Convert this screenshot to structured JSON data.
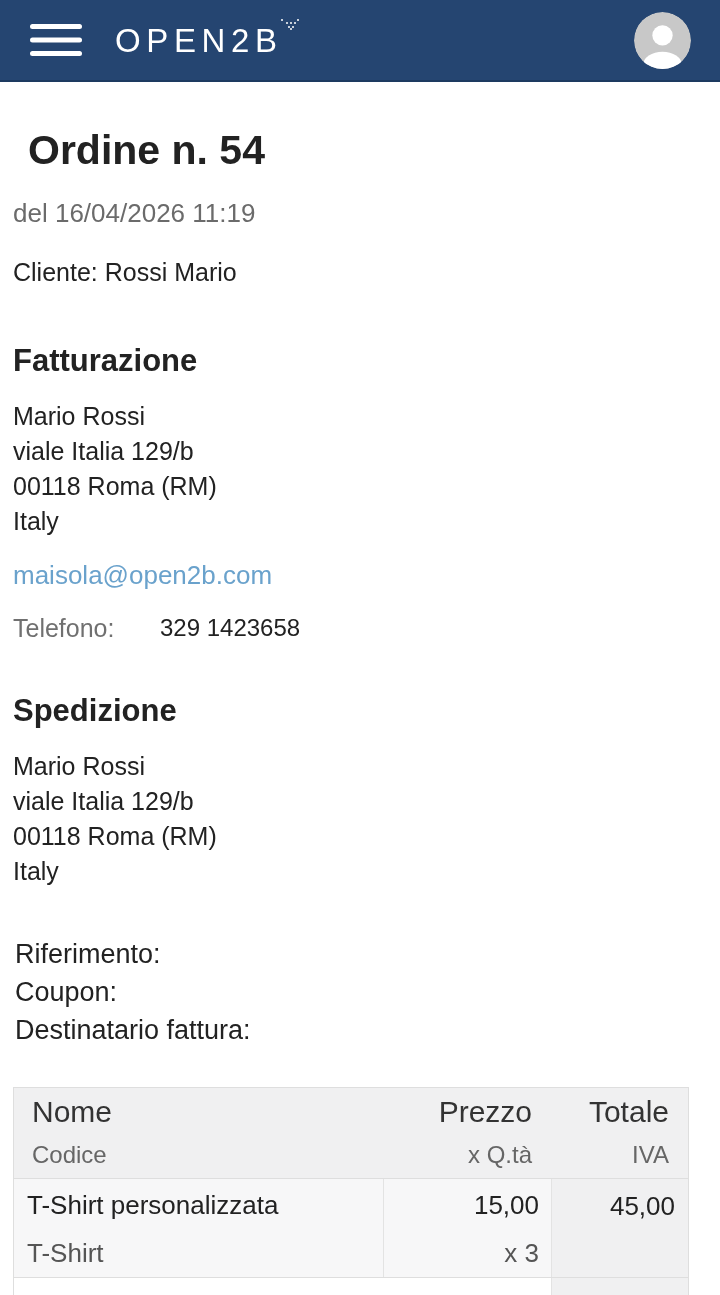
{
  "header": {
    "logo": "OPEN2B"
  },
  "order": {
    "title": "Ordine n. 54",
    "date": "del 16/04/2026 11:19",
    "customer": "Cliente: Rossi Mario"
  },
  "billing": {
    "heading": "Fatturazione",
    "address_lines": [
      "Mario Rossi",
      "viale Italia 129/b",
      "00118 Roma (RM)",
      "Italy"
    ],
    "email": "maisola@open2b.com",
    "phone": {
      "label": "Telefono:",
      "value": "329 1423658"
    }
  },
  "shipping": {
    "heading": "Spedizione",
    "address_lines": [
      "Mario Rossi",
      "viale Italia 129/b",
      "00118 Roma (RM)",
      "Italy"
    ]
  },
  "references": [
    "Riferimento:",
    "Coupon:",
    "Destinatario fattura:"
  ],
  "table": {
    "columns": [
      {
        "label": "Nome",
        "sublabel": "Codice"
      },
      {
        "label": "Prezzo",
        "sublabel": "x Q.tà"
      },
      {
        "label": "Totale",
        "sublabel": "IVA"
      }
    ],
    "rows": [
      {
        "name": "T-Shirt personalizzata",
        "code": "T-Shirt",
        "price": "15,00",
        "quantity": "x 3",
        "total": "45,00"
      }
    ]
  }
}
